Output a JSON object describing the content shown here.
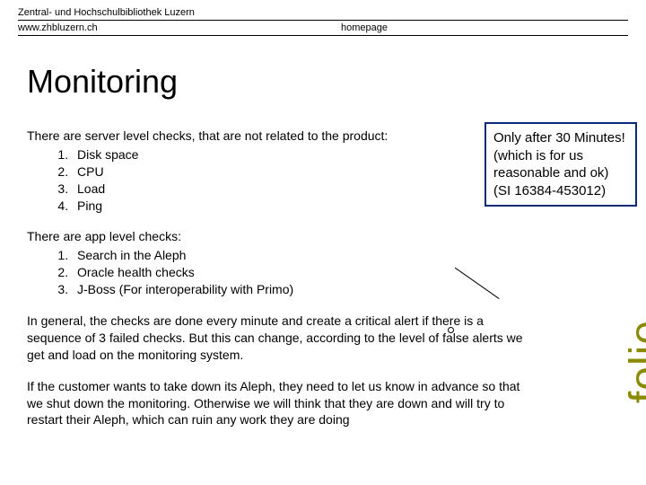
{
  "header": {
    "institution": "Zentral- und Hochschulbibliothek Luzern",
    "url": "www.zhbluzern.ch",
    "homepage_label": "homepage"
  },
  "title": "Monitoring",
  "server_checks": {
    "intro": "There are server level checks, that are not related to the product:",
    "items": [
      "Disk space",
      "CPU",
      "Load",
      "Ping"
    ]
  },
  "app_checks": {
    "intro": "There are app level checks:",
    "items": [
      "Search in the Aleph",
      "Oracle health checks",
      "J-Boss (For interoperability with Primo)"
    ]
  },
  "callout": {
    "line1": "Only after 30 Minutes!",
    "line2": "(which is for us reasonable and ok)",
    "line3": "(SI 16384-453012)"
  },
  "paragraphs": {
    "p1": "In general, the checks are done every minute and create a critical alert if there is a sequence of 3 failed checks. But this can change, according to the level of false alerts we get and load on the monitoring system.",
    "p2": "If the customer wants to take down its Aleph, they need to let us know in advance so that we shut down the monitoring. Otherwise we will think that they are down and will try to restart their Aleph, which can ruin any work they are doing"
  },
  "side_label": "folie"
}
